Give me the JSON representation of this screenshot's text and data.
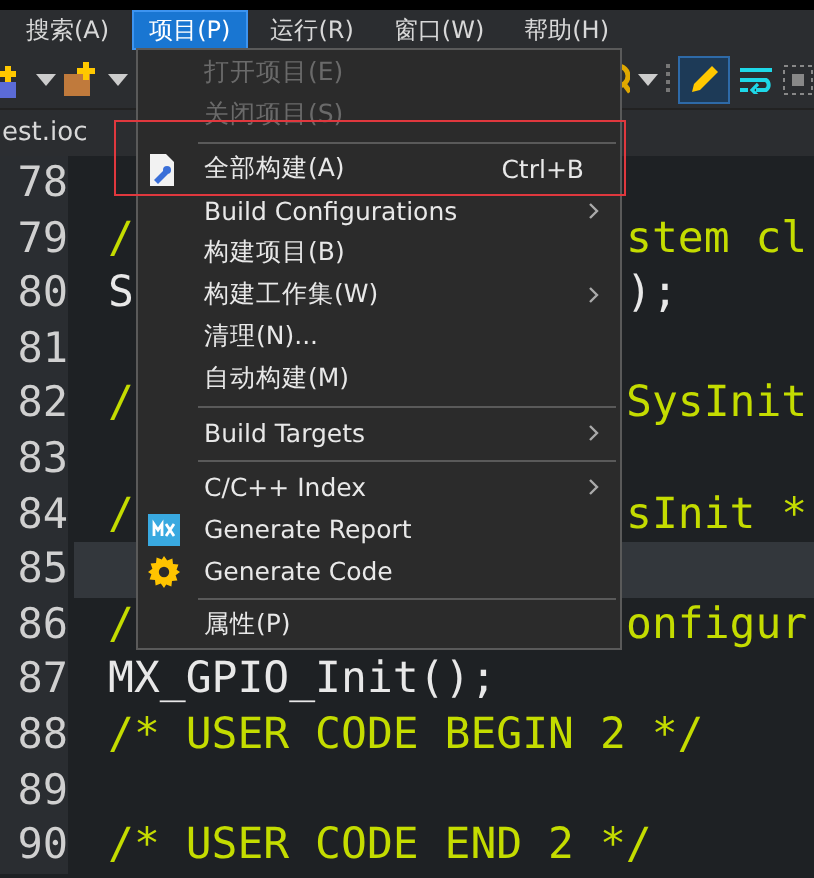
{
  "menubar": [
    {
      "label": "搜索(A)",
      "selected": false
    },
    {
      "label": "项目(P)",
      "selected": true
    },
    {
      "label": "运行(R)",
      "selected": false
    },
    {
      "label": "窗口(W)",
      "selected": false
    },
    {
      "label": "帮助(H)",
      "selected": false
    }
  ],
  "toolbar": {
    "pencil_selected": true
  },
  "tab": {
    "label": "est.ioc"
  },
  "editor": {
    "lines": [
      {
        "number": "78",
        "current": false
      },
      {
        "number": "79",
        "current": false,
        "kind": "comment",
        "left": "/",
        "right": "stem cl"
      },
      {
        "number": "80",
        "current": false,
        "kind": "code",
        "left": "S",
        "right": ");"
      },
      {
        "number": "81",
        "current": false
      },
      {
        "number": "82",
        "current": false,
        "kind": "comment",
        "left": "/",
        "right": "SysInit"
      },
      {
        "number": "83",
        "current": false
      },
      {
        "number": "84",
        "current": false,
        "kind": "comment",
        "left": "/",
        "right": "sInit *"
      },
      {
        "number": "85",
        "current": true
      },
      {
        "number": "86",
        "current": false,
        "kind": "comment",
        "left": "/",
        "right": "onfigur"
      },
      {
        "number": "87",
        "current": false,
        "kind": "code",
        "text": "MX_GPIO_Init();"
      },
      {
        "number": "88",
        "current": false,
        "kind": "comment",
        "text": "/* USER CODE BEGIN 2 */"
      },
      {
        "number": "89",
        "current": false
      },
      {
        "number": "90",
        "current": false,
        "kind": "comment",
        "text": "/* USER CODE END 2 */"
      }
    ]
  },
  "menu": {
    "items": [
      {
        "kind": "item",
        "label": "打开项目(E)",
        "disabled": true,
        "submenu": false,
        "outlined": false
      },
      {
        "kind": "item",
        "label": "关闭项目(S)",
        "disabled": true,
        "submenu": false,
        "outlined": false
      },
      {
        "kind": "separator"
      },
      {
        "kind": "item",
        "label": "全部构建(A)",
        "shortcut": "Ctrl+B",
        "disabled": false,
        "submenu": false,
        "outlined": true
      },
      {
        "kind": "item",
        "label": "Build Configurations",
        "disabled": false,
        "submenu": true,
        "outlined": false
      },
      {
        "kind": "item",
        "label": "构建项目(B)",
        "disabled": false,
        "submenu": false,
        "outlined": false
      },
      {
        "kind": "item",
        "label": "构建工作集(W)",
        "disabled": false,
        "submenu": true,
        "outlined": false
      },
      {
        "kind": "item",
        "label": "清理(N)...",
        "disabled": false,
        "submenu": false,
        "outlined": false
      },
      {
        "kind": "item",
        "label": "自动构建(M)",
        "disabled": false,
        "submenu": false,
        "outlined": false
      },
      {
        "kind": "separator"
      },
      {
        "kind": "item",
        "label": "Build Targets",
        "disabled": false,
        "submenu": true,
        "outlined": false
      },
      {
        "kind": "separator"
      },
      {
        "kind": "item",
        "label": "C/C++ Index",
        "disabled": false,
        "submenu": true,
        "outlined": false
      },
      {
        "kind": "item",
        "label": "Generate Report",
        "disabled": false,
        "submenu": false,
        "outlined": false
      },
      {
        "kind": "item",
        "label": "Generate Code",
        "disabled": false,
        "submenu": false,
        "outlined": false
      },
      {
        "kind": "separator"
      },
      {
        "kind": "item",
        "label": "属性(P)",
        "disabled": false,
        "submenu": false,
        "outlined": false
      }
    ]
  }
}
